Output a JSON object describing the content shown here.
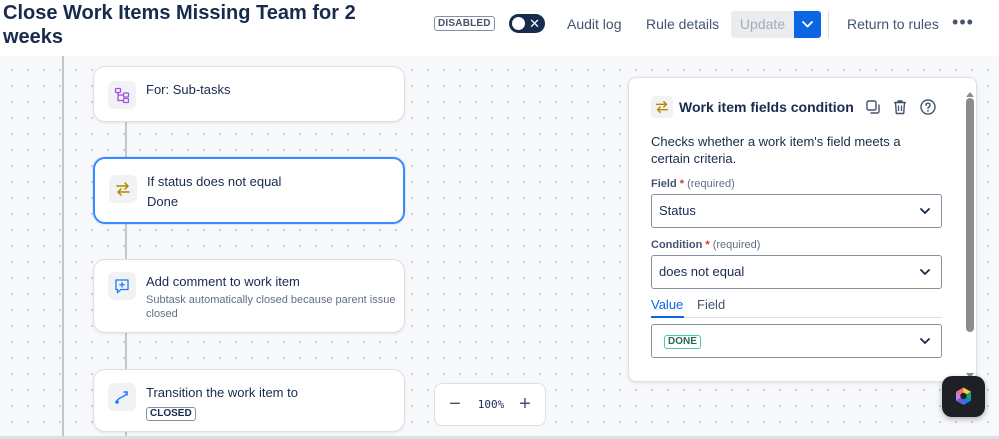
{
  "header": {
    "title": "Close Work Items Missing Team for 2 weeks",
    "status_badge": "DISABLED",
    "toggle_symbol": "✕",
    "audit_log": "Audit log",
    "rule_details": "Rule details",
    "update": "Update",
    "return_to_rules": "Return to rules",
    "more": "•••"
  },
  "flow": {
    "nodes": [
      {
        "title": "For: Sub-tasks",
        "icon": "branch-icon"
      },
      {
        "title": "If status does not equal",
        "subtitle": "Done",
        "icon": "condition-swap-icon",
        "selected": true
      },
      {
        "title": "Add comment to work item",
        "subtitle": "Subtask automatically closed because parent issue closed",
        "icon": "comment-add-icon"
      },
      {
        "title": "Transition the work item to",
        "lozenge": "CLOSED",
        "icon": "transition-icon"
      }
    ],
    "zoom": {
      "minus": "−",
      "value": "100%",
      "plus": "+"
    }
  },
  "panel": {
    "title": "Work item fields condition",
    "description": "Checks whether a work item's field meets a certain criteria.",
    "field": {
      "label": "Field",
      "required_mark": "*",
      "hint": "(required)",
      "value": "Status"
    },
    "condition": {
      "label": "Condition",
      "required_mark": "*",
      "hint": "(required)",
      "value": "does not equal"
    },
    "tabs": [
      "Value",
      "Field"
    ],
    "value_lozenge": "DONE"
  },
  "colors": {
    "primary": "#0c66e4",
    "selected_border": "#388bff",
    "done_green": "#4bce97",
    "condition_icon": "#b38600"
  }
}
